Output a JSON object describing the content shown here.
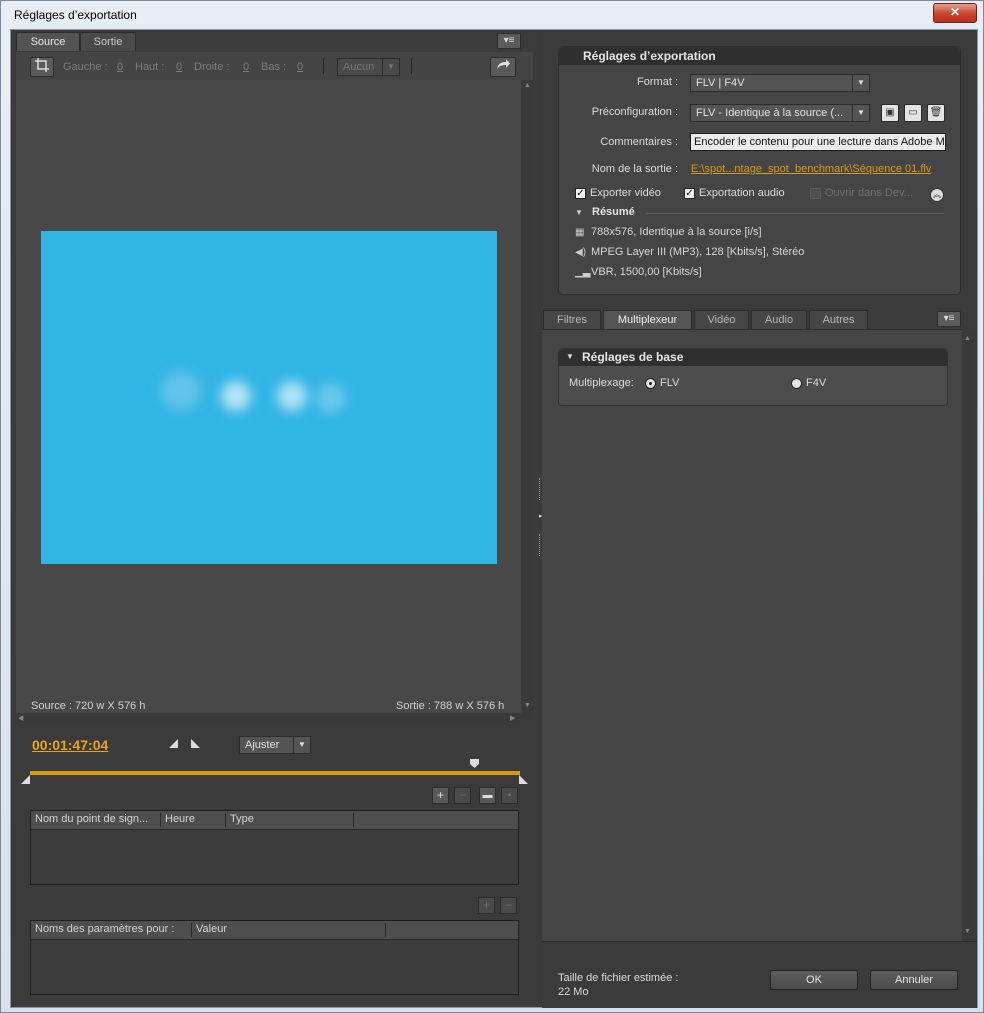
{
  "window": {
    "title": "Réglages d’exportation",
    "close_glyph": "✕"
  },
  "left": {
    "tabs": [
      {
        "label": "Source"
      },
      {
        "label": "Sortie"
      }
    ],
    "crop": {
      "left_label": "Gauche :",
      "left_value": "0",
      "top_label": "Haut :",
      "top_value": "0",
      "right_label": "Droite :",
      "right_value": "0",
      "bottom_label": "Bas :",
      "bottom_value": "0",
      "ratio_value": "Aucun"
    },
    "source_dims": "Source : 720 w X 576 h",
    "output_dims": "Sortie : 788 w X 576 h",
    "timecode": "00:01:47:04",
    "fit_value": "Ajuster",
    "cue_table": {
      "columns": [
        "Nom du point de sign...",
        "Heure",
        "Type"
      ]
    },
    "param_table": {
      "columns": [
        "Noms des paramètres pour :",
        "Valeur"
      ]
    }
  },
  "right": {
    "export_title": "Réglages d’exportation",
    "format_label": "Format :",
    "format_value": "FLV | F4V",
    "preset_label": "Préconfiguration :",
    "preset_value": "FLV - Identique à la source (...",
    "comments_label": "Commentaires :",
    "comments_value": "Encoder le contenu pour une lecture dans Adobe Me",
    "output_label": "Nom de la sortie :",
    "output_value": "E:\\spot...ntage_spot_benchmark\\Séquence 01.flv",
    "export_video": "Exporter vidéo",
    "export_audio": "Exportation audio",
    "open_in": "Ouvrir dans Dev...",
    "summary_title": "Résumé",
    "summary": [
      "788x576, Identique à la source [i/s]",
      "MPEG Layer III (MP3), 128 [Kbits/s], Stéréo",
      "VBR, 1500,00 [Kbits/s]"
    ],
    "tabs": [
      {
        "label": "Filtres"
      },
      {
        "label": "Multiplexeur"
      },
      {
        "label": "Vidéo"
      },
      {
        "label": "Audio"
      },
      {
        "label": "Autres"
      }
    ],
    "base_title": "Réglages de base",
    "mux_label": "Multiplexage:",
    "mux_options": [
      "FLV",
      "F4V"
    ],
    "size_label": "Taille de fichier estimée :",
    "size_value": "22 Mo",
    "ok_label": "OK",
    "cancel_label": "Annuler"
  }
}
